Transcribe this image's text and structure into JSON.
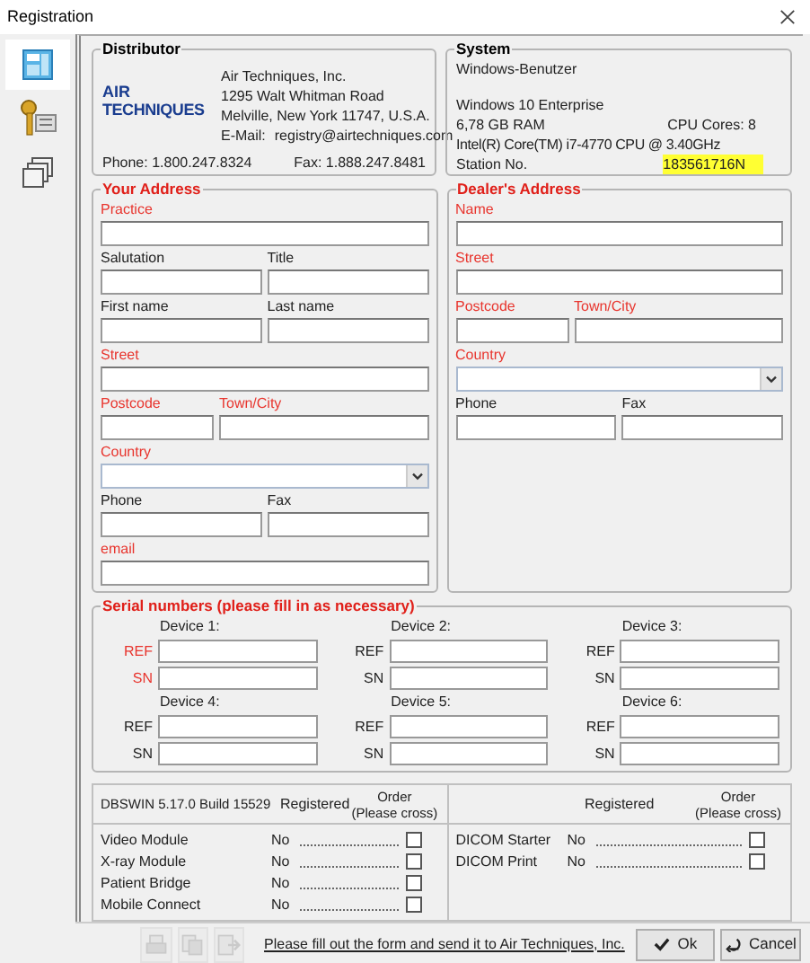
{
  "window": {
    "title": "Registration"
  },
  "sidebar": {
    "items": [
      {
        "kind": "form",
        "selected": true
      },
      {
        "kind": "key",
        "selected": false
      },
      {
        "kind": "windows",
        "selected": false
      }
    ]
  },
  "distributor": {
    "title": "Distributor",
    "logo_top": "AIR",
    "logo_bottom": "TECHNIQUES",
    "company": "Air Techniques, Inc.",
    "street": "1295 Walt Whitman Road",
    "city": "Melville, New York 11747, U.S.A.",
    "email_label": "E-Mail:",
    "email": "registry@airtechniques.com",
    "phone": "Phone: 1.800.247.8324",
    "fax": "Fax: 1.888.247.8481"
  },
  "system": {
    "title": "System",
    "user": "Windows-Benutzer",
    "os": "Windows 10 Enterprise",
    "ram": "6,78 GB RAM",
    "cpu_cores": "CPU Cores: 8",
    "cpu": "Intel(R) Core(TM) i7-4770 CPU @ 3.40GHz",
    "station_label": "Station No.",
    "station_no": "183561716N"
  },
  "your_address": {
    "title": "Your Address",
    "rows": [
      [
        {
          "label": "Practice",
          "required": true,
          "kind": "text"
        }
      ],
      [
        {
          "label": "Salutation",
          "required": false,
          "kind": "text"
        },
        {
          "label": "Title",
          "required": false,
          "kind": "text"
        }
      ],
      [
        {
          "label": "First name",
          "required": false,
          "kind": "text"
        },
        {
          "label": "Last name",
          "required": false,
          "kind": "text"
        }
      ],
      [
        {
          "label": "Street",
          "required": true,
          "kind": "text"
        }
      ],
      [
        {
          "label": "Postcode",
          "required": true,
          "kind": "short"
        },
        {
          "label": "Town/City",
          "required": true,
          "kind": "text"
        }
      ],
      [
        {
          "label": "Country",
          "required": true,
          "kind": "dropdown"
        }
      ],
      [
        {
          "label": "Phone",
          "required": false,
          "kind": "text"
        },
        {
          "label": "Fax",
          "required": false,
          "kind": "text"
        }
      ],
      [
        {
          "label": "email",
          "required": true,
          "kind": "text"
        }
      ]
    ]
  },
  "dealer_address": {
    "title": "Dealer's Address",
    "rows": [
      [
        {
          "label": "Name",
          "required": true,
          "kind": "text"
        }
      ],
      [
        {
          "label": "Street",
          "required": true,
          "kind": "text"
        }
      ],
      [
        {
          "label": "Postcode",
          "required": true,
          "kind": "short"
        },
        {
          "label": "Town/City",
          "required": true,
          "kind": "text"
        }
      ],
      [
        {
          "label": "Country",
          "required": true,
          "kind": "dropdown"
        }
      ],
      [
        {
          "label": "Phone",
          "required": false,
          "kind": "text"
        },
        {
          "label": "Fax",
          "required": false,
          "kind": "text"
        }
      ]
    ]
  },
  "serial_numbers": {
    "title": "Serial numbers (please fill in as necessary)",
    "devices": [
      {
        "label": "Device 1:",
        "ref_label": "REF",
        "sn_label": "SN",
        "required": true
      },
      {
        "label": "Device 2:",
        "ref_label": "REF",
        "sn_label": "SN",
        "required": false
      },
      {
        "label": "Device 3:",
        "ref_label": "REF",
        "sn_label": "SN",
        "required": false
      },
      {
        "label": "Device 4:",
        "ref_label": "REF",
        "sn_label": "SN",
        "required": false
      },
      {
        "label": "Device 5:",
        "ref_label": "REF",
        "sn_label": "SN",
        "required": false
      },
      {
        "label": "Device 6:",
        "ref_label": "REF",
        "sn_label": "SN",
        "required": false
      }
    ]
  },
  "modules": {
    "left": {
      "version": "DBSWIN 5.17.0 Build 15529",
      "registered_header": "Registered",
      "order_header": "Order\n(Please cross)",
      "items": [
        {
          "name": "Video Module",
          "registered": "No",
          "ordered": false
        },
        {
          "name": "X-ray Module",
          "registered": "No",
          "ordered": false
        },
        {
          "name": "Patient Bridge",
          "registered": "No",
          "ordered": false
        },
        {
          "name": "Mobile Connect",
          "registered": "No",
          "ordered": false
        }
      ]
    },
    "right": {
      "registered_header": "Registered",
      "order_header": "Order\n(Please cross)",
      "items": [
        {
          "name": "DICOM Starter",
          "registered": "No",
          "ordered": false
        },
        {
          "name": "DICOM Print",
          "registered": "No",
          "ordered": false
        }
      ]
    }
  },
  "footer": {
    "tools": [
      {
        "kind": "print",
        "disabled": true
      },
      {
        "kind": "copy",
        "disabled": true
      },
      {
        "kind": "export",
        "disabled": true
      }
    ],
    "note": "Please fill out the form and send it to Air Techniques, Inc.",
    "ok": "Ok",
    "cancel": "Cancel"
  }
}
